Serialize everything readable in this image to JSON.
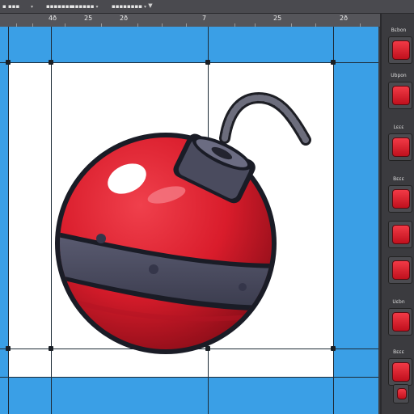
{
  "toolbar": {
    "items": [
      {
        "label": "▪ ▪▪▪",
        "arrow": "⊕"
      },
      {
        "label": "▪▪▪▪▪▪▪▪▪",
        "arrow": "▾"
      },
      {
        "label": "▪▪▪▪▪▪▪",
        "arrow": "▾"
      },
      {
        "label": "▪▪▪▪▪▪",
        "arrow": "▾"
      },
      {
        "label": "▪▪▪▪▪▪▪▪",
        "arrow": "▾"
      }
    ],
    "dropdown_icon": "filter-dropdown-icon"
  },
  "ruler": {
    "ticks": [
      "4ð",
      "25",
      "2ð",
      "7",
      "25",
      "2ð"
    ]
  },
  "canvas": {
    "background_color": "#3a9fe6",
    "object": "bomb-sprite"
  },
  "panel": {
    "labels": [
      "Bɛbon",
      "Ubpon",
      "Lɛɛɛ",
      "Bɛɛɛ",
      "Uɛbn",
      "Bɛɛɛ"
    ],
    "swatch_color": "#e0202e"
  }
}
